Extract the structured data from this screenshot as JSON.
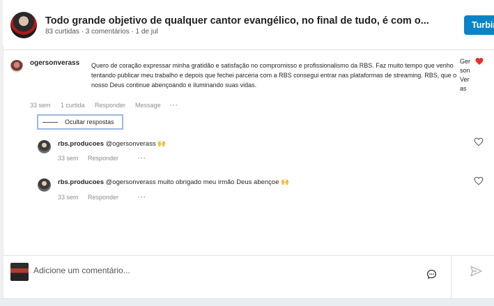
{
  "post": {
    "title": "Todo grande objetivo de qualquer cantor evangélico, no final de tudo, é com o...",
    "meta": "83 curtidas · 3 comentários · 1 de jul",
    "boost_label": "Turbin"
  },
  "comment": {
    "username": "ogersonverass",
    "text": "Quero de coração expressar minha gratidão e satisfação no compromisso e profissionalismo da RBS. Faz muito tempo que venho tentando publicar meu trabalho e depois que fechei parceria com a RBS consegui entrar nas plataformas de streaming. RBS, que o nosso Deus continue abençoando e iluminando suas vidas.",
    "side_name": "Gerson Veras",
    "time": "33 sem",
    "likes": "1 curtida",
    "reply_label": "Responder",
    "message_label": "Message",
    "more": "···",
    "hide_replies_label": "Ocultar respostas"
  },
  "replies": [
    {
      "username": "rbs.producoes",
      "text": "@ogersonverass 🙌",
      "time": "33 sem",
      "reply_label": "Responder",
      "more": "···"
    },
    {
      "username": "rbs.producoes",
      "text": "@ogersonverass muito obrigado meu irmão Deus abençoe 🙌",
      "time": "33 sem",
      "reply_label": "Responder",
      "more": "···"
    }
  ],
  "composer": {
    "placeholder": "Adicione um comentário..."
  },
  "icons": {
    "heart_liked": "heart-filled-icon",
    "heart": "heart-outline-icon",
    "emoji": "emoji-icon",
    "send": "send-icon"
  },
  "colors": {
    "accent": "#0a84c9",
    "heart": "#e5312b",
    "muted": "#8e8e8e"
  }
}
